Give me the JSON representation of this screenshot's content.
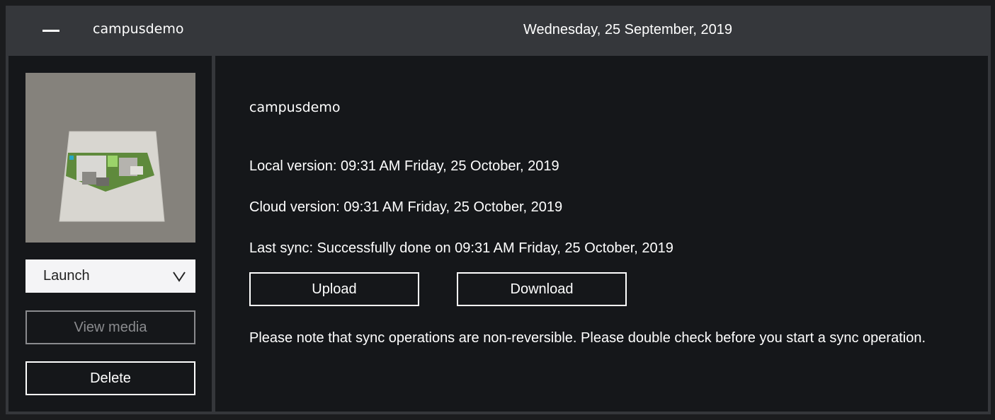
{
  "header": {
    "collapse_icon": "minus-icon",
    "title": "campusdemo",
    "date": "Wednesday, 25 September, 2019"
  },
  "sidebar": {
    "thumbnail_icon": "project-thumbnail",
    "launch_select": {
      "value": "Launch",
      "icon": "chevron-down-icon"
    },
    "view_media_label": "View media",
    "view_media_disabled": true,
    "delete_label": "Delete"
  },
  "details": {
    "project_name": "campusdemo",
    "local_version": "Local version: 09:31 AM Friday, 25 October, 2019",
    "cloud_version": "Cloud version: 09:31 AM Friday, 25 October, 2019",
    "last_sync": "Last sync: Successfully done on 09:31 AM Friday, 25 October, 2019",
    "upload_label": "Upload",
    "download_label": "Download",
    "note": "Please note that sync operations are non-reversible. Please double check before you start a sync operation."
  },
  "colors": {
    "header_bg": "#35373b",
    "panel_bg": "#15171a",
    "text": "#ffffff",
    "disabled": "#8a8b8e"
  }
}
